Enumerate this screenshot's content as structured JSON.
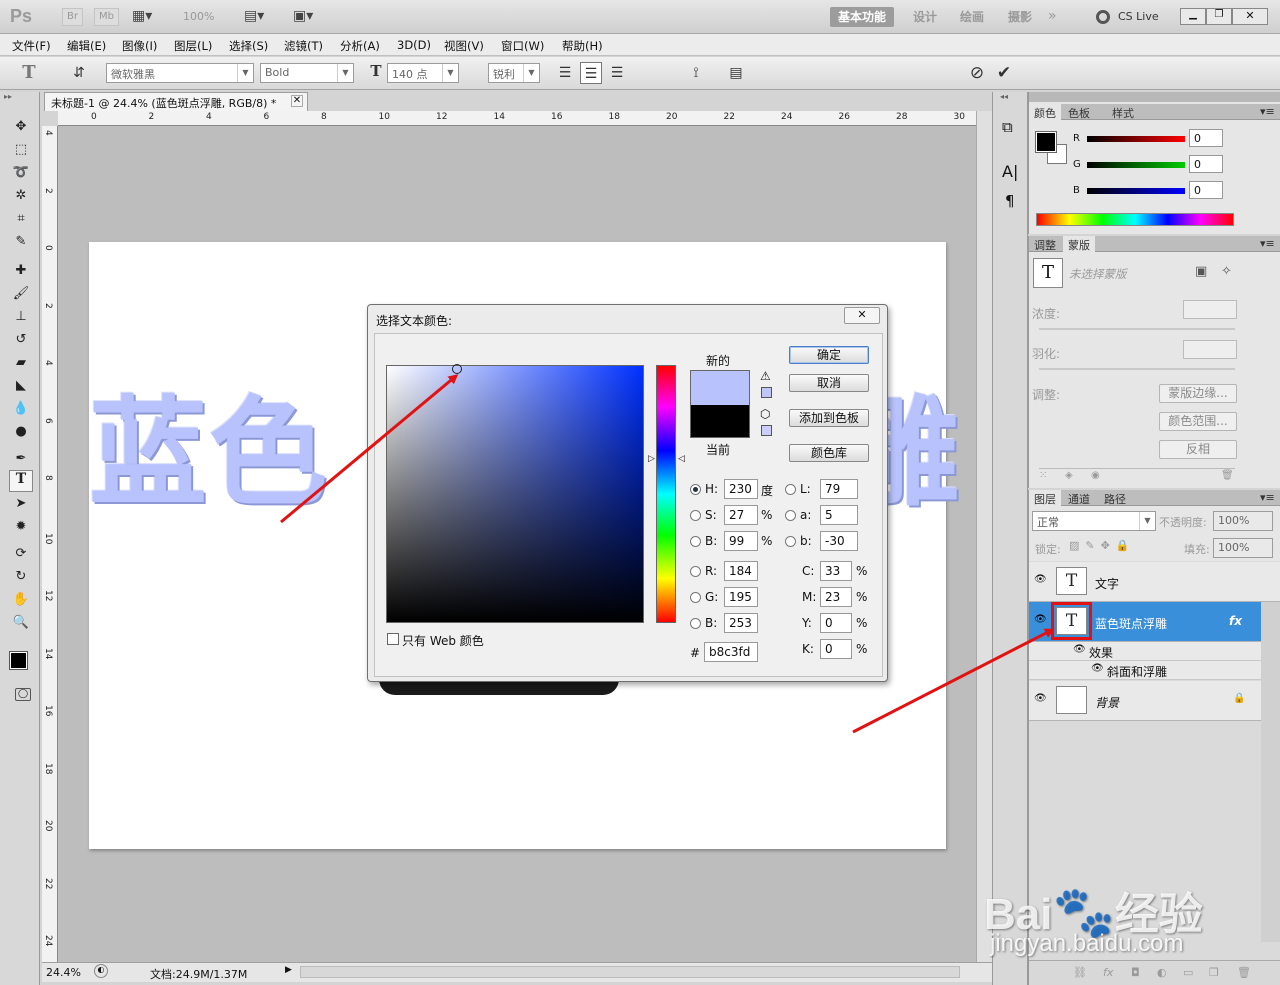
{
  "app": {
    "logo": "Ps",
    "zoom": "100%",
    "workspace": [
      "基本功能",
      "设计",
      "绘画",
      "摄影"
    ],
    "cslive": "CS Live"
  },
  "menu": [
    "文件(F)",
    "编辑(E)",
    "图像(I)",
    "图层(L)",
    "选择(S)",
    "滤镜(T)",
    "分析(A)",
    "3D(D)",
    "视图(V)",
    "窗口(W)",
    "帮助(H)"
  ],
  "options": {
    "font_family": "微软雅黑",
    "font_style": "Bold",
    "font_size": "140 点",
    "aa_label": "a",
    "antialias": "锐利",
    "text_color": "#b8c3fd"
  },
  "document": {
    "tab_title": "未标题-1 @ 24.4% (蓝色斑点浮雕, RGB/8) *",
    "canvas_text": "蓝色",
    "canvas_text_right": "雕"
  },
  "ruler": {
    "h": [
      "0",
      "2",
      "4",
      "6",
      "8",
      "10",
      "12",
      "14",
      "16",
      "18",
      "20",
      "22",
      "24",
      "26",
      "28",
      "30"
    ],
    "v": [
      "4",
      "2",
      "0",
      "2",
      "4",
      "6",
      "8",
      "10",
      "12",
      "14",
      "16",
      "18",
      "20",
      "22",
      "24"
    ]
  },
  "status": {
    "zoom": "24.4%",
    "doc": "文档:24.9M/1.37M"
  },
  "color_panel": {
    "tabs": [
      "颜色",
      "色板",
      "样式"
    ],
    "r": "0",
    "g": "0",
    "b": "0",
    "r_label": "R",
    "g_label": "G",
    "b_label": "B"
  },
  "mask_panel": {
    "tabs": [
      "调整",
      "蒙版"
    ],
    "no_mask": "未选择蒙版",
    "density": "浓度:",
    "feather": "羽化:",
    "adjust": "调整:",
    "btn_edge": "蒙版边缘...",
    "btn_range": "颜色范围...",
    "btn_invert": "反相"
  },
  "layers_panel": {
    "tabs": [
      "图层",
      "通道",
      "路径"
    ],
    "blend_mode": "正常",
    "opacity_label": "不透明度:",
    "opacity": "100%",
    "lock_label": "锁定:",
    "fill_label": "填充:",
    "fill": "100%",
    "layers": [
      {
        "name": "文字"
      },
      {
        "name": "蓝色斑点浮雕",
        "fx": "fx"
      },
      {
        "name": "背景"
      }
    ],
    "effects": "效果",
    "bevel": "斜面和浮雕"
  },
  "dialog": {
    "title": "选择文本颜色:",
    "new_label": "新的",
    "current_label": "当前",
    "new_color": "#b8c3fd",
    "current_color": "#000000",
    "buttons": {
      "ok": "确定",
      "cancel": "取消",
      "add_swatch": "添加到色板",
      "library": "颜色库"
    },
    "fields": {
      "H": "230",
      "S": "27",
      "B": "99",
      "R": "184",
      "G": "195",
      "Bv": "253",
      "L": "79",
      "a": "5",
      "b": "-30",
      "C": "33",
      "M": "23",
      "Y": "0",
      "K": "0",
      "hex": "b8c3fd"
    },
    "units": {
      "deg": "度",
      "pct": "%"
    },
    "field_labels": {
      "H": "H:",
      "S": "S:",
      "B": "B:",
      "R": "R:",
      "G": "G:",
      "Bv": "B:",
      "L": "L:",
      "a": "a:",
      "b": "b:",
      "C": "C:",
      "M": "M:",
      "Y": "Y:",
      "K": "K:",
      "hex": "#"
    },
    "web_only": "只有 Web 颜色"
  },
  "watermark": {
    "brand": "Bai",
    "brand2": "经验",
    "url": "jingyan.baidu.com"
  }
}
